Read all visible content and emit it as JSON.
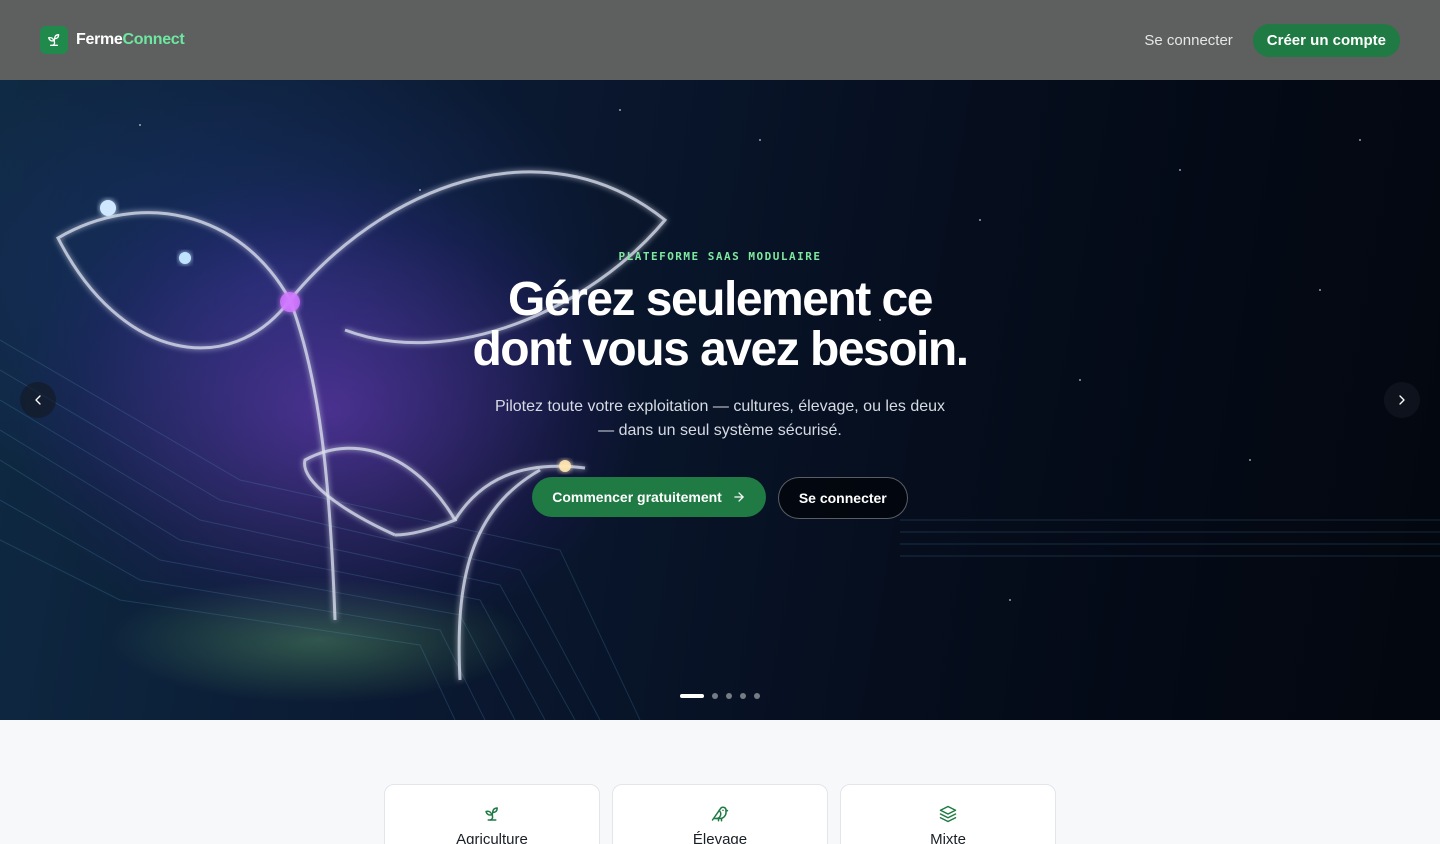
{
  "header": {
    "brand_part1": "Ferme",
    "brand_part2": "Connect",
    "login_label": "Se connecter",
    "signup_label": "Créer un compte"
  },
  "hero": {
    "eyebrow": "PLATEFORME SAAS MODULAIRE",
    "headline_line1": "Gérez seulement ce",
    "headline_line2": "dont vous avez besoin.",
    "subline": "Pilotez toute votre exploitation — cultures, élevage, ou les deux — dans un seul système sécurisé.",
    "primary_cta": "Commencer gratuitement",
    "secondary_cta": "Se connecter",
    "slide_count": 5,
    "active_slide": 1
  },
  "modules": {
    "items": [
      {
        "label": "Agriculture",
        "icon": "sprout-icon"
      },
      {
        "label": "Élevage",
        "icon": "bird-icon"
      },
      {
        "label": "Mixte",
        "icon": "layers-icon"
      }
    ]
  },
  "colors": {
    "brand_green": "#1f7a43",
    "accent_green": "#6ee7a0",
    "header_bg": "#5e5f5f"
  }
}
